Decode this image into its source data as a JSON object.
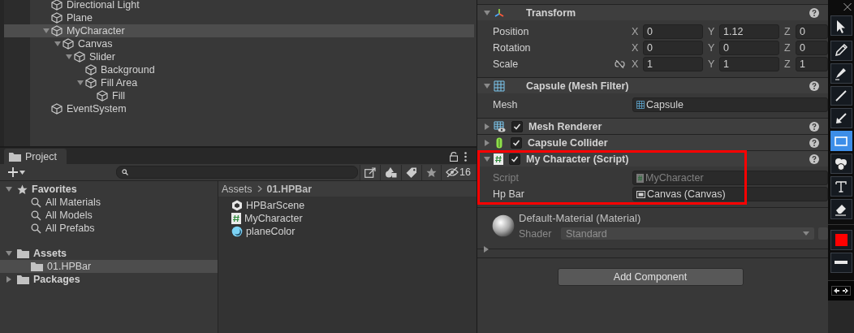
{
  "hierarchy": {
    "items": [
      {
        "label": "Directional Light",
        "selected": false
      },
      {
        "label": "Plane",
        "selected": false
      },
      {
        "label": "MyCharacter",
        "selected": true,
        "expanded": true,
        "children": [
          {
            "label": "Canvas",
            "selected": false,
            "expanded": true,
            "children": [
              {
                "label": "Slider",
                "selected": false,
                "expanded": true,
                "children": [
                  {
                    "label": "Background",
                    "selected": false
                  },
                  {
                    "label": "Fill Area",
                    "selected": false,
                    "expanded": true,
                    "children": [
                      {
                        "label": "Fill",
                        "selected": false
                      }
                    ]
                  }
                ]
              }
            ]
          }
        ]
      },
      {
        "label": "EventSystem",
        "selected": false
      }
    ]
  },
  "project": {
    "tab": "Project",
    "hidden_count": "16",
    "tree": [
      {
        "label": "Favorites",
        "kind": "favorites",
        "expanded": true,
        "selected": false,
        "children": [
          {
            "label": "All Materials",
            "kind": "search",
            "selected": false
          },
          {
            "label": "All Models",
            "kind": "search",
            "selected": false
          },
          {
            "label": "All Prefabs",
            "kind": "search",
            "selected": false
          }
        ]
      },
      {
        "label": "Assets",
        "kind": "folder",
        "expanded": true,
        "selected": false,
        "children": [
          {
            "label": "01.HPBar",
            "kind": "folder",
            "selected": true
          }
        ]
      },
      {
        "label": "Packages",
        "kind": "folder",
        "expanded": false,
        "selected": false
      }
    ],
    "breadcrumb": [
      "Assets",
      "01.HPBar"
    ],
    "files": [
      {
        "name": "HPBarScene",
        "kind": "scene"
      },
      {
        "name": "MyCharacter",
        "kind": "script"
      },
      {
        "name": "planeColor",
        "kind": "material"
      }
    ]
  },
  "inspector": {
    "components": [
      {
        "kind": "transform",
        "title": "Transform",
        "expanded": true,
        "rows": [
          {
            "label": "Position",
            "link": false,
            "fields": [
              {
                "axis": "X",
                "value": "0"
              },
              {
                "axis": "Y",
                "value": "1.12"
              },
              {
                "axis": "Z",
                "value": "0"
              }
            ]
          },
          {
            "label": "Rotation",
            "link": false,
            "fields": [
              {
                "axis": "X",
                "value": "0"
              },
              {
                "axis": "Y",
                "value": "0"
              },
              {
                "axis": "Z",
                "value": "0"
              }
            ]
          },
          {
            "label": "Scale",
            "link": true,
            "fields": [
              {
                "axis": "X",
                "value": "1"
              },
              {
                "axis": "Y",
                "value": "1"
              },
              {
                "axis": "Z",
                "value": "1"
              }
            ]
          }
        ]
      },
      {
        "kind": "mesh_filter",
        "title": "Capsule (Mesh Filter)",
        "expanded": true,
        "annotated": false,
        "props": [
          {
            "label": "Mesh",
            "value": "Capsule",
            "kind": "mesh",
            "disabled": false
          }
        ]
      },
      {
        "kind": "mesh_renderer",
        "title": "Mesh Renderer",
        "expanded": false,
        "enabled": true,
        "annotated": false
      },
      {
        "kind": "capsule_collider",
        "title": "Capsule Collider",
        "expanded": false,
        "enabled": true,
        "annotated": false
      },
      {
        "kind": "script",
        "title": "My Character (Script)",
        "expanded": true,
        "enabled": true,
        "annotated": true,
        "props": [
          {
            "label": "Script",
            "value": "MyCharacter",
            "kind": "script",
            "disabled": true
          },
          {
            "label": "Hp Bar",
            "value": "Canvas (Canvas)",
            "kind": "canvas",
            "disabled": false
          }
        ]
      }
    ],
    "material": {
      "name": "Default-Material (Material)",
      "expanded": false,
      "shader_label": "Shader",
      "shader": "Standard"
    },
    "add_button": "Add Component"
  },
  "annotation_toolbar": {
    "tools": [
      {
        "kind": "select",
        "selected": false
      },
      {
        "kind": "pencil",
        "selected": false
      },
      {
        "kind": "marker",
        "selected": false
      },
      {
        "kind": "line",
        "selected": false
      },
      {
        "kind": "arrow",
        "selected": false
      },
      {
        "kind": "rectangle",
        "selected": true
      },
      {
        "kind": "counter",
        "selected": false
      },
      {
        "kind": "text",
        "selected": false
      },
      {
        "kind": "eraser",
        "selected": false
      }
    ],
    "color": "#ff0000"
  }
}
